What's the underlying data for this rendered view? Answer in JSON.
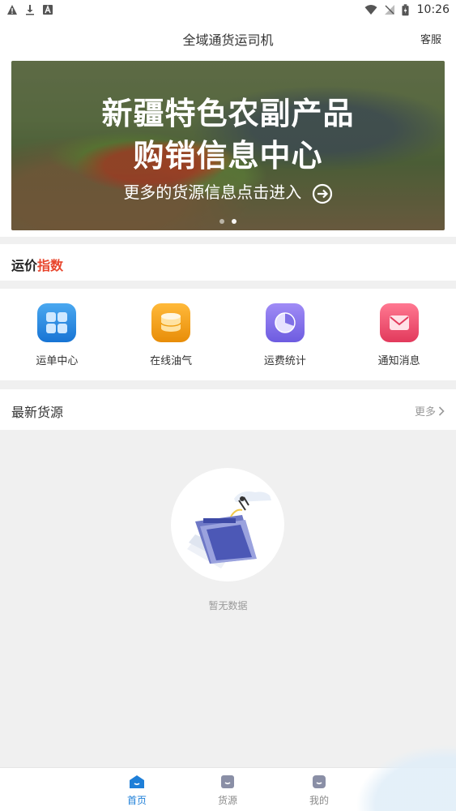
{
  "status_bar": {
    "time": "10:26"
  },
  "header": {
    "title": "全域通货运司机",
    "service": "客服"
  },
  "banner": {
    "line1": "新疆特色农副产品",
    "line2": "购销信息中心",
    "line3": "更多的货源信息点击进入",
    "slides": 2,
    "active_slide": 2
  },
  "freight_index": {
    "part1": "运价",
    "part2": "指数"
  },
  "actions": [
    {
      "label": "运单中心",
      "icon": "grid-icon",
      "color": "#1f86e0"
    },
    {
      "label": "在线油气",
      "icon": "fuel-tank-icon",
      "color": "#f0a012"
    },
    {
      "label": "运费统计",
      "icon": "pie-chart-icon",
      "color": "#7f6fe6"
    },
    {
      "label": "通知消息",
      "icon": "mail-icon",
      "color": "#ee4d6e"
    }
  ],
  "latest": {
    "title": "最新货源",
    "more": "更多"
  },
  "empty": {
    "text": "暂无数据"
  },
  "tabs": [
    {
      "label": "首页",
      "active": true
    },
    {
      "label": "货源",
      "active": false
    },
    {
      "label": "我的",
      "active": false
    }
  ],
  "colors": {
    "accent": "#1e7fd8",
    "index_red": "#e8452c"
  }
}
